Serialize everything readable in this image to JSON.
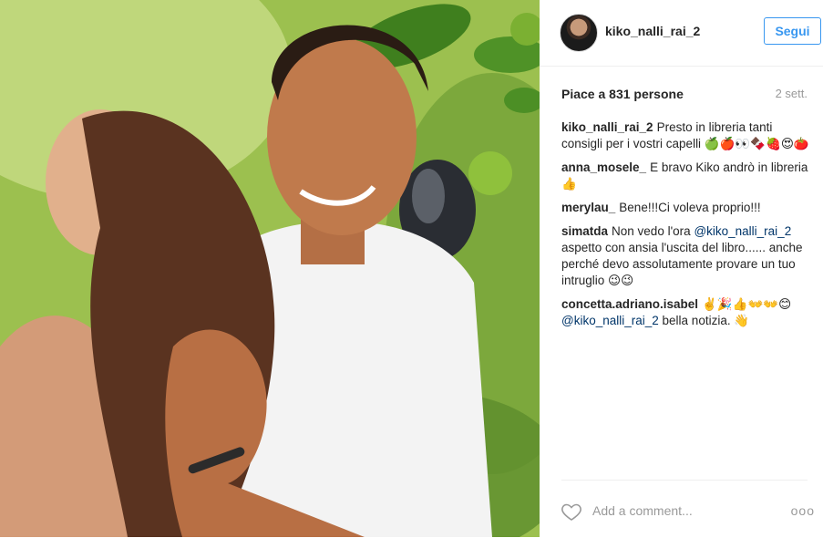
{
  "post": {
    "image_alt": "Photo of a smiling man in a white t-shirt holding the hair of a woman, outdoors among green foliage and a lime tree"
  },
  "header": {
    "username": "kiko_nalli_rai_2",
    "follow_label": "Segui"
  },
  "stats": {
    "likes": "Piace a 831 persone",
    "time": "2 sett."
  },
  "comments": [
    {
      "user": "kiko_nalli_rai_2",
      "text": "Presto in libreria tanti consigli per i vostri capelli 🍏🍎👀🍫🍓😍🍅"
    },
    {
      "user": "anna_mosele_",
      "text": "E bravo Kiko andrò in libreria👍"
    },
    {
      "user": "merylau_",
      "text": "Bene!!!Ci voleva proprio!!!"
    },
    {
      "user": "simatda",
      "text_before": "Non vedo l'ora",
      "mention": "@kiko_nalli_rai_2",
      "text_after": "aspetto con ansia l'uscita del libro...... anche perché devo assolutamente provare un tuo intruglio 😉😉"
    },
    {
      "user": "concetta.adriano.isabel",
      "text_before": "✌️🎉👍👐👐😊",
      "mention": "@kiko_nalli_rai_2",
      "text_after": "bella notizia. 👋"
    }
  ],
  "footer": {
    "add_comment_placeholder": "Add a comment...",
    "more_label": "ooo"
  },
  "colors": {
    "accent": "#3897f0",
    "mention": "#003569",
    "muted": "#999999"
  },
  "icons": {
    "like": "heart-outline-icon",
    "more": "more-options-icon"
  }
}
